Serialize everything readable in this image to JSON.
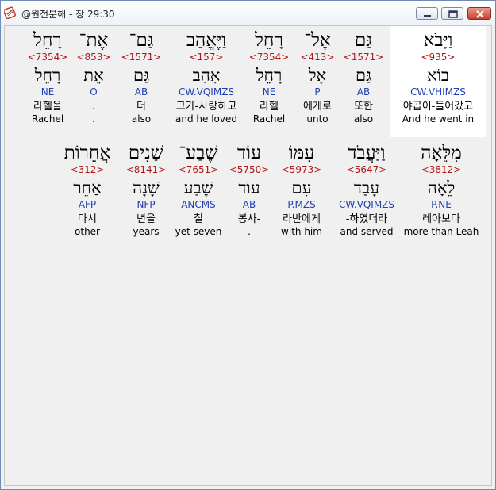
{
  "window": {
    "title": "@원전분해 - 창 29:30"
  },
  "rows": [
    [
      {
        "hebrew": "וַיָּבֹא",
        "strong": "<935>",
        "lemma": "בוֹא",
        "morph": "CW.VHIMZS",
        "korean": "야곱이-들어갔고",
        "english": "And he went in"
      },
      {
        "hebrew": "גַּם",
        "strong": "<1571>",
        "lemma": "גַּם",
        "morph": "AB",
        "korean": "또한",
        "english": "also"
      },
      {
        "hebrew": "אֶל־",
        "strong": "<413>",
        "lemma": "אֶל",
        "morph": "P",
        "korean": "에게로",
        "english": "unto"
      },
      {
        "hebrew": "רָחֵל",
        "strong": "<7354>",
        "lemma": "רָחֵל",
        "morph": "NE",
        "korean": "라헬",
        "english": "Rachel"
      },
      {
        "hebrew": "וַיֶּאֱהַב",
        "strong": "<157>",
        "lemma": "אָהַב",
        "morph": "CW.VQIMZS",
        "korean": "그가-사랑하고",
        "english": "and he loved"
      },
      {
        "hebrew": "גַּם־",
        "strong": "<1571>",
        "lemma": "גַּם",
        "morph": "AB",
        "korean": "더",
        "english": "also"
      },
      {
        "hebrew": "אֶת־",
        "strong": "<853>",
        "lemma": "אֵת",
        "morph": "O",
        "korean": ".",
        "english": "."
      },
      {
        "hebrew": "רָחֵל",
        "strong": "<7354>",
        "lemma": "רָחֵל",
        "morph": "NE",
        "korean": "라헬을",
        "english": "Rachel"
      }
    ],
    [
      {
        "hebrew": "מִלֵּאָה",
        "strong": "<3812>",
        "lemma": "לֵאָה",
        "morph": "P.NE",
        "korean": "레아보다",
        "english": "more than Leah"
      },
      {
        "hebrew": "וַיַּעֲבֹד",
        "strong": "<5647>",
        "lemma": "עָבַד",
        "morph": "CW.VQIMZS",
        "korean": "-하였더라",
        "english": "and served"
      },
      {
        "hebrew": "עִמּוֹ",
        "strong": "<5973>",
        "lemma": "עִם",
        "morph": "P.MZS",
        "korean": "라반에게",
        "english": "with him"
      },
      {
        "hebrew": "עוֹד",
        "strong": "<5750>",
        "lemma": "עוֹד",
        "morph": "AB",
        "korean": "봉사-",
        "english": "."
      },
      {
        "hebrew": "שֶׁבַע־",
        "strong": "<7651>",
        "lemma": "שֶׁבַע",
        "morph": "ANCMS",
        "korean": "칠",
        "english": "yet seven"
      },
      {
        "hebrew": "שָׁנִים",
        "strong": "<8141>",
        "lemma": "שָׁנָה",
        "morph": "NFP",
        "korean": "년을",
        "english": "years"
      },
      {
        "hebrew": "אֲחֵרוֹת׃",
        "strong": "<312>",
        "lemma": "אַחֵר",
        "morph": "AFP",
        "korean": "다시",
        "english": "other"
      }
    ]
  ]
}
